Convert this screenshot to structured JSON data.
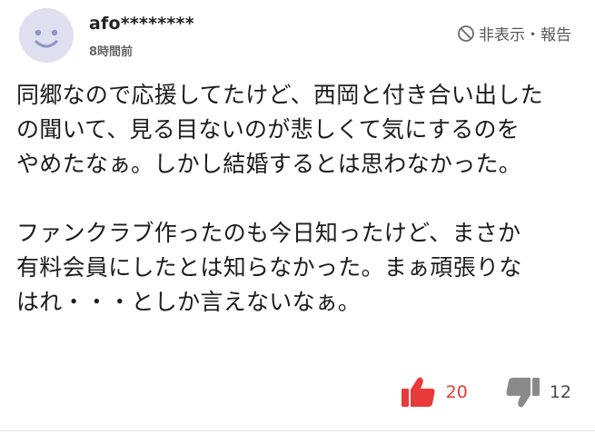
{
  "comment": {
    "user_name": "afo********",
    "timestamp": "8時間前",
    "hide_report_label": "非表示・報告",
    "paragraphs": [
      "同郷なので応援してたけど、西岡と付き合い出した\nの聞いて、見る目ないのが悲しくて気にするのを\nやめたなぁ。しかし結婚するとは思わなかった。",
      "ファンクラブ作ったのも今日知ったけど、まさか\n有料会員にしたとは知らなかった。まぁ頑張りな\nはれ・・・としか言えないなぁ。"
    ],
    "likes": "20",
    "dislikes": "12"
  },
  "icons": {
    "avatar": "smiley-face-icon",
    "hide": "prohibited-circle-icon",
    "like": "thumbs-up-icon",
    "dislike": "thumbs-down-icon"
  },
  "colors": {
    "avatar_bg": "#dfe0ef",
    "avatar_face": "#8e98c6",
    "like": "#e83a3a",
    "dislike": "#8a8a8a"
  }
}
